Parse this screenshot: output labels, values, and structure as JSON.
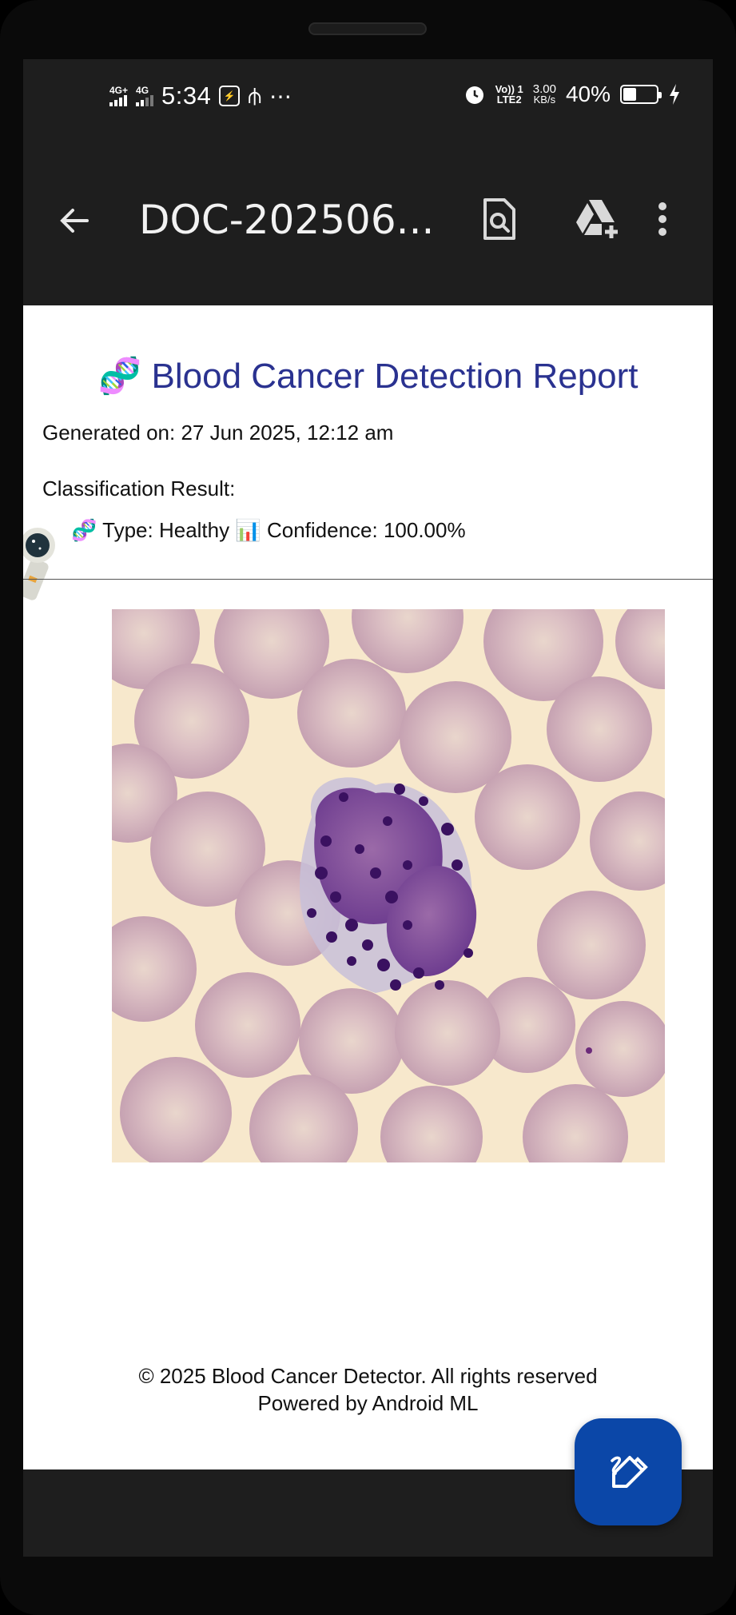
{
  "status_bar": {
    "net1": "4G+",
    "net2": "4G",
    "time": "5:34",
    "volte_top": "Vo)) 1",
    "volte_bottom": "LTE2",
    "speed_value": "3.00",
    "speed_unit": "KB/s",
    "battery_percent": "40%",
    "battery_level": 0.4,
    "icons": [
      "signal-icon",
      "usb-icon",
      "more-icon",
      "alarm-icon",
      "battery-icon",
      "charging-icon"
    ]
  },
  "app_bar": {
    "title": "DOC-202506...",
    "icons": [
      "back-arrow-icon",
      "search-document-icon",
      "google-drive-add-icon",
      "more-vertical-icon"
    ]
  },
  "report": {
    "title_emoji": "🧬",
    "title": "Blood Cancer Detection Report",
    "generated_on": "Generated on: 27 Jun 2025, 12:12 am",
    "classification_label": "Classification Result:",
    "type_emoji": "🧬",
    "type_text": "Type: Healthy",
    "confidence_emoji": "📊",
    "confidence_text": "Confidence: 100.00%",
    "footer_line1": "© 2025 Blood Cancer Detector. All rights reserved",
    "footer_line2": "Powered by Android ML"
  },
  "fab": {
    "icon": "edit-pen-icon"
  },
  "colors": {
    "title_blue": "#2a3290",
    "fab_blue": "#0b47a8",
    "dark_bg": "#1e1e1e"
  }
}
